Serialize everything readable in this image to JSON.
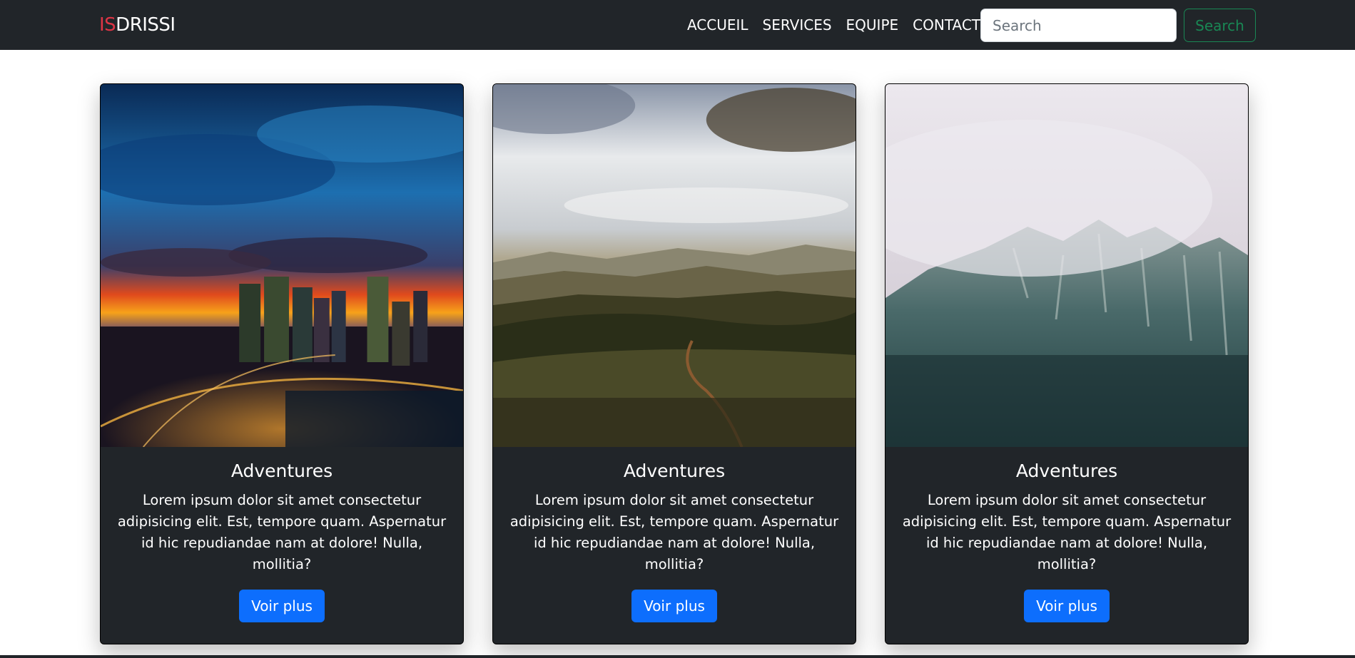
{
  "navbar": {
    "brand_accent": "IS",
    "brand_rest": "DRISSI",
    "links": [
      "ACCUEIL",
      "SERVICES",
      "EQUIPE",
      "CONTACT"
    ],
    "search_placeholder": "Search",
    "search_button": "Search"
  },
  "cards": [
    {
      "image": "city-skyline-sunset",
      "title": "Adventures",
      "text": "Lorem ipsum dolor sit amet consectetur adipisicing elit. Est, tempore quam. Aspernatur id hic repudiandae nam at dolore! Nulla, mollitia?",
      "button": "Voir plus"
    },
    {
      "image": "valley-landscape",
      "title": "Adventures",
      "text": "Lorem ipsum dolor sit amet consectetur adipisicing elit. Est, tempore quam. Aspernatur id hic repudiandae nam at dolore! Nulla, mollitia?",
      "button": "Voir plus"
    },
    {
      "image": "misty-mountain",
      "title": "Adventures",
      "text": "Lorem ipsum dolor sit amet consectetur adipisicing elit. Est, tempore quam. Aspernatur id hic repudiandae nam at dolore! Nulla, mollitia?",
      "button": "Voir plus"
    }
  ],
  "colors": {
    "navbar_bg": "#212529",
    "brand_accent": "#dc3545",
    "search_button": "#198754",
    "card_button": "#0d6efd"
  }
}
